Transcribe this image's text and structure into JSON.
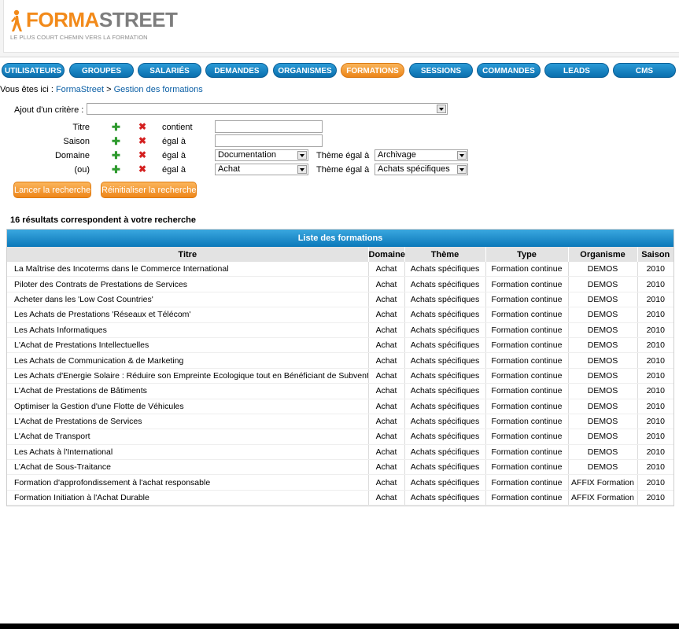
{
  "logo": {
    "forma": "FORMA",
    "street": "STREET",
    "tagline": "LE PLUS COURT CHEMIN VERS LA FORMATION"
  },
  "nav": [
    {
      "label": "UTILISATEURS",
      "active": false
    },
    {
      "label": "GROUPES",
      "active": false
    },
    {
      "label": "SALARIÉS",
      "active": false
    },
    {
      "label": "DEMANDES",
      "active": false
    },
    {
      "label": "ORGANISMES",
      "active": false
    },
    {
      "label": "FORMATIONS",
      "active": true
    },
    {
      "label": "SESSIONS",
      "active": false
    },
    {
      "label": "COMMANDES",
      "active": false
    },
    {
      "label": "LEADS",
      "active": false
    },
    {
      "label": "CMS",
      "active": false
    }
  ],
  "breadcrumb": {
    "prefix": "Vous êtes ici : ",
    "home": "FormaStreet",
    "sep": " > ",
    "current": "Gestion des formations"
  },
  "criteria": {
    "add_label": "Ajout d'un critère :",
    "add_value": "",
    "rows": [
      {
        "label": "Titre",
        "op": "contient",
        "value": ""
      },
      {
        "label": "Saison",
        "op": "égal à",
        "value": ""
      },
      {
        "label": "Domaine",
        "op": "égal à",
        "value": "Documentation",
        "theme_label": "Thème égal à",
        "theme_value": "Archivage"
      },
      {
        "label": "(ou)",
        "op": "égal à",
        "value": "Achat",
        "theme_label": "Thème égal à",
        "theme_value": "Achats spécifiques"
      }
    ]
  },
  "buttons": {
    "search": "Lancer la recherche",
    "reset": "Réinitialiser la recherche"
  },
  "results": {
    "count_text": "16 résultats correspondent à votre recherche",
    "caption": "Liste des formations",
    "columns": [
      "Titre",
      "Domaine",
      "Thème",
      "Type",
      "Organisme",
      "Saison"
    ],
    "rows": [
      [
        "La Maîtrise des Incoterms dans le Commerce International",
        "Achat",
        "Achats spécifiques",
        "Formation continue",
        "DEMOS",
        "2010"
      ],
      [
        "Piloter des Contrats de Prestations de Services",
        "Achat",
        "Achats spécifiques",
        "Formation continue",
        "DEMOS",
        "2010"
      ],
      [
        "Acheter dans les 'Low Cost Countries'",
        "Achat",
        "Achats spécifiques",
        "Formation continue",
        "DEMOS",
        "2010"
      ],
      [
        "Les Achats de Prestations 'Réseaux et Télécom'",
        "Achat",
        "Achats spécifiques",
        "Formation continue",
        "DEMOS",
        "2010"
      ],
      [
        "Les Achats Informatiques",
        "Achat",
        "Achats spécifiques",
        "Formation continue",
        "DEMOS",
        "2010"
      ],
      [
        "L'Achat de Prestations Intellectuelles",
        "Achat",
        "Achats spécifiques",
        "Formation continue",
        "DEMOS",
        "2010"
      ],
      [
        "Les Achats de Communication & de Marketing",
        "Achat",
        "Achats spécifiques",
        "Formation continue",
        "DEMOS",
        "2010"
      ],
      [
        "Les Achats d'Energie Solaire : Réduire son Empreinte Ecologique tout en Bénéficiant de Subventions",
        "Achat",
        "Achats spécifiques",
        "Formation continue",
        "DEMOS",
        "2010"
      ],
      [
        "L'Achat de Prestations de Bâtiments",
        "Achat",
        "Achats spécifiques",
        "Formation continue",
        "DEMOS",
        "2010"
      ],
      [
        "Optimiser la Gestion d'une Flotte de Véhicules",
        "Achat",
        "Achats spécifiques",
        "Formation continue",
        "DEMOS",
        "2010"
      ],
      [
        "L'Achat de Prestations de Services",
        "Achat",
        "Achats spécifiques",
        "Formation continue",
        "DEMOS",
        "2010"
      ],
      [
        "L'Achat de Transport",
        "Achat",
        "Achats spécifiques",
        "Formation continue",
        "DEMOS",
        "2010"
      ],
      [
        "Les Achats à l'International",
        "Achat",
        "Achats spécifiques",
        "Formation continue",
        "DEMOS",
        "2010"
      ],
      [
        "L'Achat de Sous-Traitance",
        "Achat",
        "Achats spécifiques",
        "Formation continue",
        "DEMOS",
        "2010"
      ],
      [
        "Formation d'approfondissement à l'achat responsable",
        "Achat",
        "Achats spécifiques",
        "Formation continue",
        "AFFIX Formation",
        "2010"
      ],
      [
        "Formation Initiation à l'Achat Durable",
        "Achat",
        "Achats spécifiques",
        "Formation continue",
        "AFFIX Formation",
        "2010"
      ]
    ]
  },
  "colors": {
    "brand_orange": "#f28a1a",
    "nav_blue": "#0a6fae",
    "nav_active": "#ec8519",
    "link_blue": "#0b5fa5"
  }
}
